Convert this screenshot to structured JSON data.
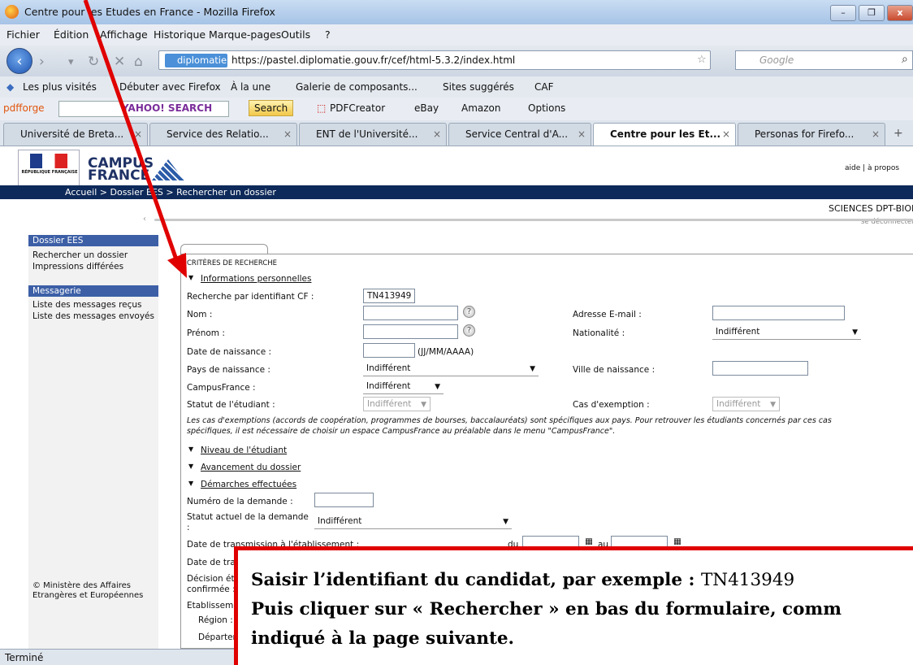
{
  "window": {
    "title": "Centre pour les Etudes en France - Mozilla Firefox",
    "minimize": "–",
    "restore": "❐",
    "close": "x"
  },
  "menu": [
    "Fichier",
    "Édition",
    "Affichage",
    "Historique",
    "Marque-pages",
    "Outils",
    "?"
  ],
  "nav": {
    "identity": "diplomatie.gouv.fr",
    "url": "https://pastel.diplomatie.gouv.fr/cef/html-5.3.2/index.html",
    "search_placeholder": "Google"
  },
  "bookmarks": [
    "Les plus visités",
    "Débuter avec Firefox",
    "À la une",
    "Galerie de composants...",
    "Sites suggérés",
    "CAF"
  ],
  "toolbar": {
    "pdfforge": "pdfforge",
    "yahoo": "YAHOO! SEARCH",
    "search_button": "Search",
    "pdfcreator": "PDFCreator",
    "ebay": "eBay",
    "amazon": "Amazon",
    "options": "Options"
  },
  "tabs": [
    {
      "label": "Université de Breta..."
    },
    {
      "label": "Service des Relatio..."
    },
    {
      "label": "ENT de l'Université..."
    },
    {
      "label": "Service Central d'A..."
    },
    {
      "label": "Centre pour les Et..."
    },
    {
      "label": "Personas for Firefo..."
    }
  ],
  "site": {
    "logo_line1": "CAMPUS",
    "logo_line2": "FRANCE",
    "top_links": "aide  |  à propos",
    "breadcrumb": "Accueil > Dossier EES > Rechercher un dossier",
    "user": "SCIENCES DPT-BIOLOGIE",
    "logout": "se déconnecter",
    "ministry": "RÉPUBLIQUE FRANÇAISE"
  },
  "sidebar": {
    "dossier_head": "Dossier EES",
    "dossier_items": [
      "Rechercher un dossier",
      "Impressions différées"
    ],
    "msg_head": "Messagerie",
    "msg_items": [
      "Liste des messages reçus",
      "Liste des messages envoyés"
    ],
    "footer_line1": "© Ministère des Affaires",
    "footer_line2": "Etrangères et Européennes"
  },
  "form": {
    "tab_title": "CRITÈRES DE RECHERCHE",
    "sect_perso": "Informations personnelles",
    "lbl_id": "Recherche par identifiant CF :",
    "val_id": "TN413949",
    "lbl_nom": "Nom :",
    "lbl_email": "Adresse E-mail :",
    "lbl_prenom": "Prénom :",
    "lbl_nationalite": "Nationalité :",
    "val_nationalite": "Indifférent",
    "lbl_naissance": "Date de naissance :",
    "fmt_date": "(JJ/MM/AAAA)",
    "lbl_pays": "Pays de naissance :",
    "val_pays": "Indifférent",
    "lbl_ville": "Ville de naissance :",
    "lbl_campus": "CampusFrance :",
    "val_campus": "Indifférent",
    "lbl_statut": "Statut de l'étudiant :",
    "val_statut": "Indifférent",
    "lbl_exemption": "Cas d'exemption :",
    "val_exemption": "Indifférent",
    "note1": "Les cas d'exemptions (accords de coopération, programmes de bourses, baccalauréats) sont spécifiques aux pays. Pour retrouver les étudiants concernés par ces cas",
    "note2": "spécifiques, il est nécessaire de choisir un espace CampusFrance au préalable dans le menu \"CampusFrance\".",
    "sect_niveau": "Niveau de l'étudiant",
    "sect_avancement": "Avancement du dossier",
    "sect_demarches": "Démarches effectuées",
    "lbl_numero": "Numéro de la demande :",
    "lbl_statut_dem": "Statut actuel de la demande",
    "colon": ":",
    "val_statut_dem": "Indifférent",
    "lbl_transmission": "Date de transmission à l'établissement :",
    "du": "du",
    "au": "au",
    "lbl_date_tra": "Date de tra",
    "lbl_decision1": "Décision ét",
    "lbl_decision2": "confirmée :",
    "lbl_etab": "Etablisseme",
    "lbl_region": "Région :",
    "lbl_depart": "Départer"
  },
  "status": "Terminé",
  "annotation": {
    "line1_bold": "Saisir l’identifiant du candidat, par exemple : ",
    "line1_value": "TN413949",
    "line2": "Puis cliquer sur « Rechercher » en bas du formulaire, comm",
    "line3": "indiqué à la page suivante."
  },
  "colors": {
    "accent_red": "#e00000",
    "sidebar_head": "#3c5fa6",
    "header_band": "#0e2a5a"
  }
}
